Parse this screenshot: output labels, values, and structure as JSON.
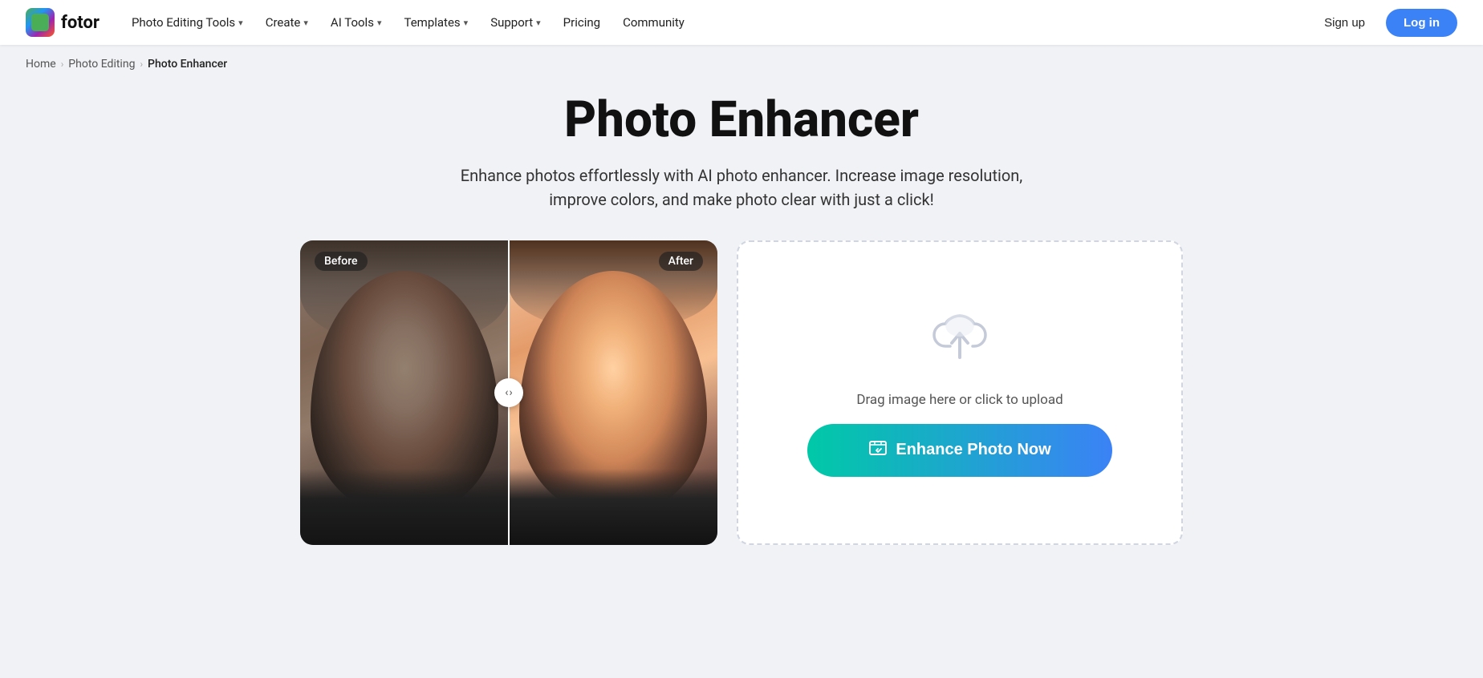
{
  "logo": {
    "text": "fotor",
    "icon": "🎨"
  },
  "nav": {
    "items": [
      {
        "label": "Photo Editing Tools",
        "hasDropdown": true
      },
      {
        "label": "Create",
        "hasDropdown": true
      },
      {
        "label": "AI Tools",
        "hasDropdown": true
      },
      {
        "label": "Templates",
        "hasDropdown": true
      },
      {
        "label": "Support",
        "hasDropdown": true
      },
      {
        "label": "Pricing",
        "hasDropdown": false
      },
      {
        "label": "Community",
        "hasDropdown": false
      }
    ],
    "signup_label": "Sign up",
    "login_label": "Log in"
  },
  "breadcrumb": {
    "home": "Home",
    "photo_editing": "Photo Editing",
    "current": "Photo Enhancer"
  },
  "hero": {
    "title": "Photo Enhancer",
    "subtitle": "Enhance photos effortlessly with AI photo enhancer. Increase image resolution, improve colors, and make photo clear with just a click!"
  },
  "demo": {
    "before_label": "Before",
    "after_label": "After"
  },
  "upload": {
    "drag_text": "Drag image here or click to upload",
    "enhance_button": "Enhance Photo Now"
  }
}
